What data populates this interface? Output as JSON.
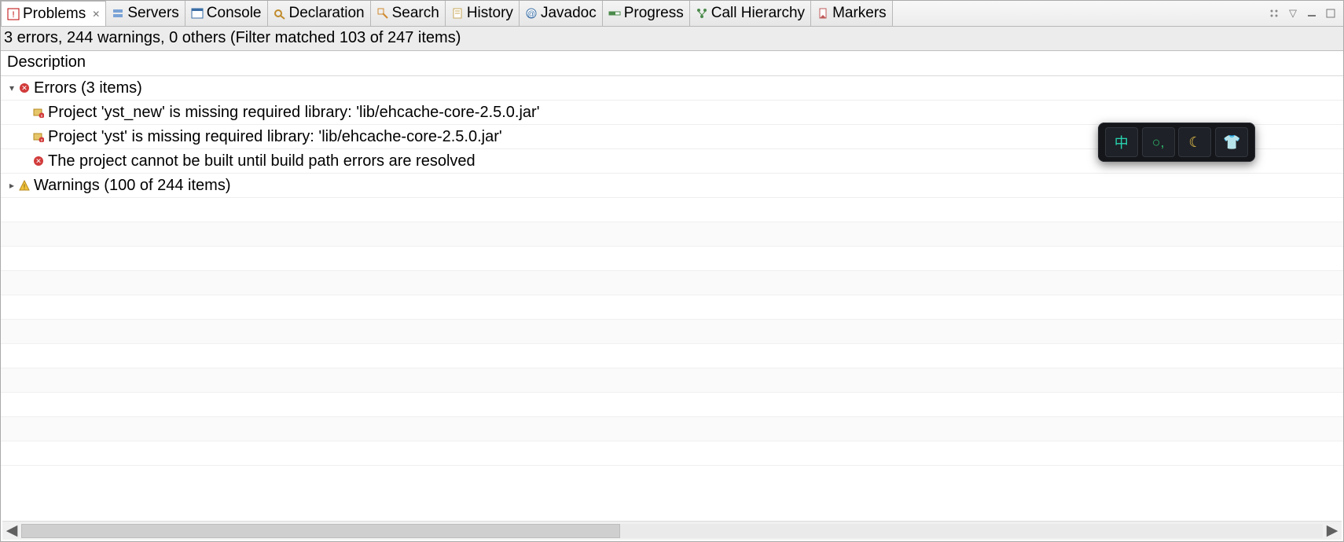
{
  "tabs": [
    {
      "label": "Problems",
      "icon": "problems"
    },
    {
      "label": "Servers",
      "icon": "servers"
    },
    {
      "label": "Console",
      "icon": "console"
    },
    {
      "label": "Declaration",
      "icon": "declaration"
    },
    {
      "label": "Search",
      "icon": "search"
    },
    {
      "label": "History",
      "icon": "history"
    },
    {
      "label": "Javadoc",
      "icon": "javadoc"
    },
    {
      "label": "Progress",
      "icon": "progress"
    },
    {
      "label": "Call Hierarchy",
      "icon": "callhierarchy"
    },
    {
      "label": "Markers",
      "icon": "markers"
    }
  ],
  "active_tab_index": 0,
  "summary": "3 errors, 244 warnings, 0 others (Filter matched 103 of 247 items)",
  "column_header": "Description",
  "tree": {
    "errors_group": {
      "label": "Errors (3 items)",
      "expanded": true
    },
    "error_items": [
      {
        "text": "Project 'yst_new' is missing required library: 'lib/ehcache-core-2.5.0.jar'",
        "icon": "buildpath-error"
      },
      {
        "text": "Project 'yst' is missing required library: 'lib/ehcache-core-2.5.0.jar'",
        "icon": "buildpath-error"
      },
      {
        "text": "The project cannot be built until build path errors are resolved",
        "icon": "error"
      }
    ],
    "warnings_group": {
      "label": "Warnings (100 of 244 items)",
      "expanded": false
    }
  },
  "ime": {
    "buttons": [
      "中",
      "○,",
      "☾",
      "👕"
    ]
  }
}
